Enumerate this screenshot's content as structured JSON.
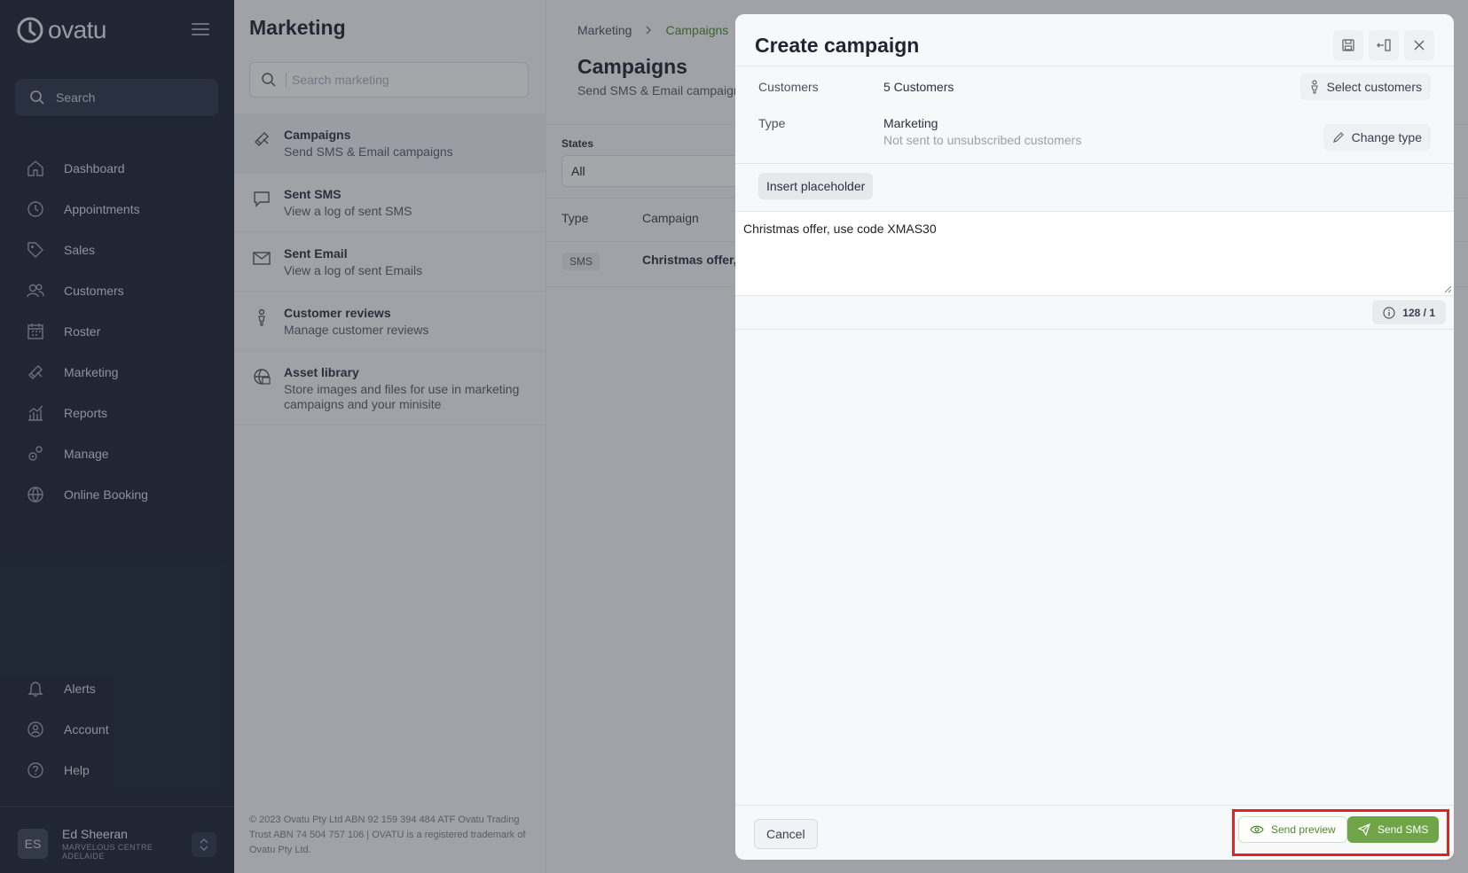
{
  "app": {
    "logo_text": "ovatu",
    "search_label": "Search"
  },
  "nav": {
    "items": [
      {
        "label": "Dashboard",
        "icon": "home-icon"
      },
      {
        "label": "Appointments",
        "icon": "clock-icon"
      },
      {
        "label": "Sales",
        "icon": "tag-icon"
      },
      {
        "label": "Customers",
        "icon": "users-icon"
      },
      {
        "label": "Roster",
        "icon": "calendar-icon"
      },
      {
        "label": "Marketing",
        "icon": "megaphone-icon"
      },
      {
        "label": "Reports",
        "icon": "chart-icon"
      },
      {
        "label": "Manage",
        "icon": "gears-icon"
      },
      {
        "label": "Online Booking",
        "icon": "globe-icon"
      }
    ],
    "bottom": [
      {
        "label": "Alerts",
        "icon": "bell-icon"
      },
      {
        "label": "Account",
        "icon": "account-icon"
      },
      {
        "label": "Help",
        "icon": "help-icon"
      }
    ]
  },
  "user": {
    "initials": "ES",
    "name": "Ed Sheeran",
    "location": "MARVELOUS CENTRE ADELAIDE"
  },
  "marketing": {
    "title": "Marketing",
    "search_placeholder": "Search marketing",
    "items": [
      {
        "title": "Campaigns",
        "subtitle": "Send SMS & Email campaigns"
      },
      {
        "title": "Sent SMS",
        "subtitle": "View a log of sent SMS"
      },
      {
        "title": "Sent Email",
        "subtitle": "View a log of sent Emails"
      },
      {
        "title": "Customer reviews",
        "subtitle": "Manage customer reviews"
      },
      {
        "title": "Asset library",
        "subtitle": "Store images and files for use in marketing campaigns and your minisite"
      }
    ],
    "footer": "© 2023 Ovatu Pty Ltd ABN 92 159 394 484 ATF Ovatu Trading Trust ABN 74 504 757 106 | OVATU is a registered trademark of Ovatu Pty Ltd."
  },
  "campaigns": {
    "breadcrumb": [
      "Marketing",
      "Campaigns"
    ],
    "title": "Campaigns",
    "subtitle": "Send SMS & Email campaigns",
    "states_label": "States",
    "states_value": "All",
    "columns": [
      "Type",
      "Campaign"
    ],
    "rows": [
      {
        "type": "SMS",
        "campaign": "Christmas offer,"
      }
    ]
  },
  "modal": {
    "title": "Create campaign",
    "customers_label": "Customers",
    "customers_value": "5 Customers",
    "select_customers": "Select customers",
    "type_label": "Type",
    "type_value": "Marketing",
    "type_note": "Not sent to unsubscribed customers",
    "change_type": "Change type",
    "insert_placeholder": "Insert placeholder",
    "message": "Christmas offer, use code XMAS30",
    "counter": "128 / 1",
    "cancel": "Cancel",
    "send_preview": "Send preview",
    "send_sms": "Send SMS"
  },
  "colors": {
    "sidebar_bg": "#1b2435",
    "accent_green": "#6fa548",
    "highlight_red": "#e0241b"
  }
}
